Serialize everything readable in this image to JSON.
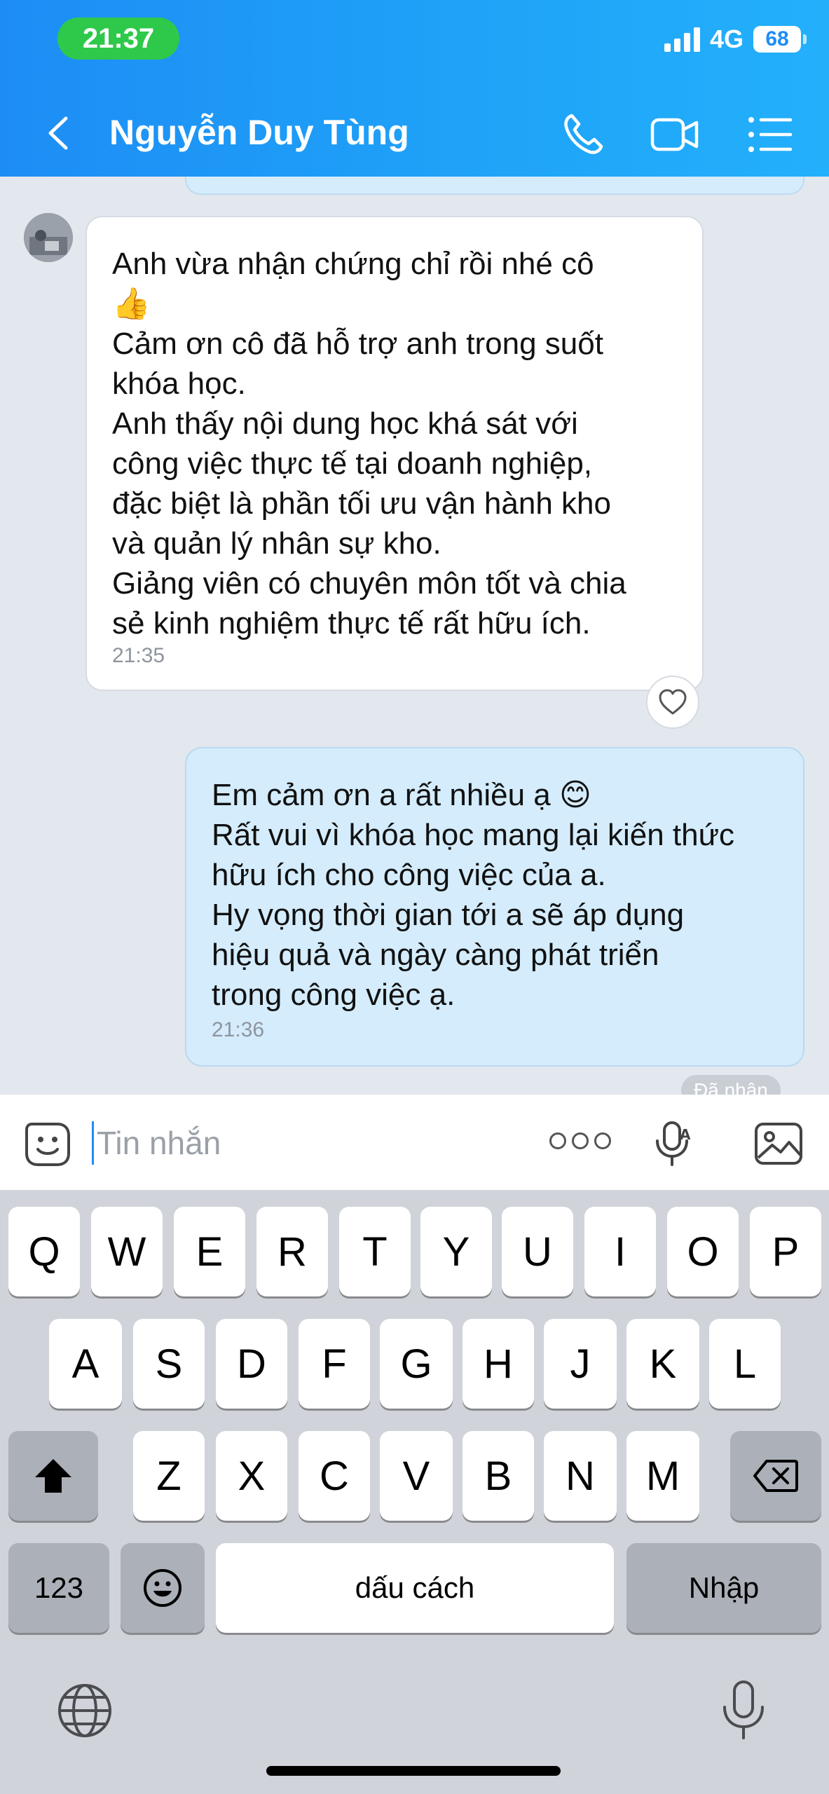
{
  "status_bar": {
    "time": "21:37",
    "network": "4G",
    "battery": "68"
  },
  "header": {
    "contact_name": "Nguyễn Duy Tùng"
  },
  "messages": [
    {
      "direction": "incoming",
      "lines": [
        "Anh vừa nhận chứng chỉ rồi nhé cô",
        "👍",
        "Cảm ơn cô đã hỗ trợ anh trong suốt",
        "khóa học.",
        "Anh thấy nội dung học khá sát với",
        "công việc thực tế tại doanh nghiệp,",
        "đặc biệt là phần tối ưu vận hành kho",
        "và quản lý nhân sự kho.",
        "Giảng viên có chuyên môn tốt và chia",
        "sẻ kinh nghiệm thực tế rất hữu ích."
      ],
      "time": "21:35"
    },
    {
      "direction": "outgoing",
      "lines": [
        "Em cảm ơn a rất nhiều ạ 😊",
        "Rất vui vì khóa học mang lại kiến thức",
        "hữu ích cho công việc của a.",
        "Hy vọng thời gian tới a sẽ áp dụng",
        "hiệu quả và ngày càng phát triển",
        "trong công việc ạ."
      ],
      "time": "21:36",
      "status": "Đã nhận"
    }
  ],
  "composer": {
    "placeholder": "Tin nhắn"
  },
  "keyboard": {
    "row1": [
      "Q",
      "W",
      "E",
      "R",
      "T",
      "Y",
      "U",
      "I",
      "O",
      "P"
    ],
    "row2": [
      "A",
      "S",
      "D",
      "F",
      "G",
      "H",
      "J",
      "K",
      "L"
    ],
    "row3": [
      "Z",
      "X",
      "C",
      "V",
      "B",
      "N",
      "M"
    ],
    "numbers_key": "123",
    "space_key": "dấu cách",
    "return_key": "Nhập"
  },
  "colors": {
    "header_blue": "#1d8df5",
    "outgoing_bubble": "#d4ecfc",
    "chat_background": "#e3e7ee",
    "time_pill_green": "#2ec94a"
  }
}
